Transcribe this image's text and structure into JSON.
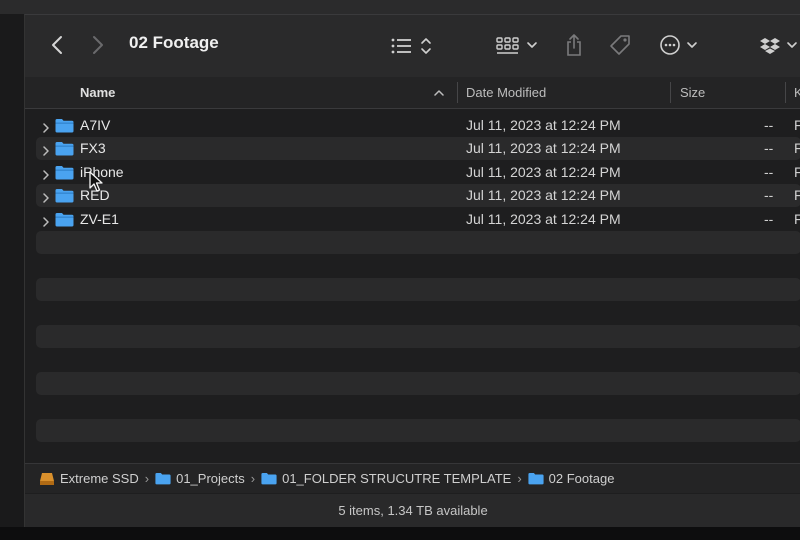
{
  "toolbar": {
    "title": "02 Footage",
    "icons": [
      "back-chevron-icon",
      "forward-chevron-icon",
      "list-view-icon",
      "group-grid-icon",
      "share-icon",
      "tag-icon",
      "more-ellipsis-icon",
      "dropbox-icon"
    ]
  },
  "columns": {
    "name": "Name",
    "date": "Date Modified",
    "size": "Size",
    "kind": "K"
  },
  "rows": [
    {
      "name": "A7IV",
      "date": "Jul 11, 2023 at 12:24 PM",
      "size": "--",
      "kind": "F"
    },
    {
      "name": "FX3",
      "date": "Jul 11, 2023 at 12:24 PM",
      "size": "--",
      "kind": "F"
    },
    {
      "name": "iPhone",
      "date": "Jul 11, 2023 at 12:24 PM",
      "size": "--",
      "kind": "F"
    },
    {
      "name": "RED",
      "date": "Jul 11, 2023 at 12:24 PM",
      "size": "--",
      "kind": "F"
    },
    {
      "name": "ZV-E1",
      "date": "Jul 11, 2023 at 12:24 PM",
      "size": "--",
      "kind": "F"
    }
  ],
  "path": [
    {
      "label": "Extreme SSD",
      "icon": "drive-icon"
    },
    {
      "label": "01_Projects",
      "icon": "folder-icon"
    },
    {
      "label": "01_FOLDER STRUCUTRE TEMPLATE",
      "icon": "folder-icon"
    },
    {
      "label": "02 Footage",
      "icon": "folder-icon"
    }
  ],
  "path_separator": "›",
  "status": "5 items, 1.34 TB available",
  "colors": {
    "folder": "#4aa3f0",
    "window_bg": "#1e1e1f",
    "toolbar_bg": "#2a2a2b",
    "stripe": "#2a2a2b",
    "drive": "#d9902c"
  }
}
